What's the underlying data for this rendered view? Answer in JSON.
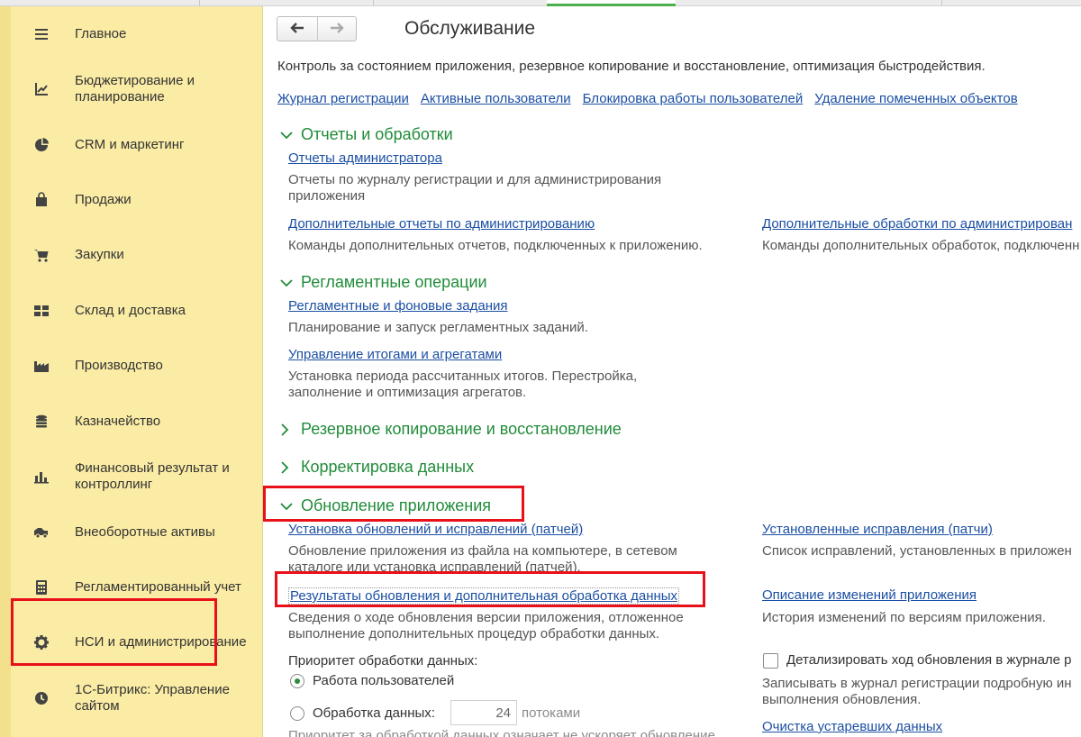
{
  "sidebar": {
    "items": [
      {
        "label": "Главное",
        "icon": "menu-icon"
      },
      {
        "label": "Бюджетирование и планирование",
        "icon": "budget-chart-icon"
      },
      {
        "label": "CRM и маркетинг",
        "icon": "pie-chart-icon"
      },
      {
        "label": "Продажи",
        "icon": "shopping-bag-icon"
      },
      {
        "label": "Закупки",
        "icon": "cart-icon"
      },
      {
        "label": "Склад и доставка",
        "icon": "grid-icon"
      },
      {
        "label": "Производство",
        "icon": "factory-icon"
      },
      {
        "label": "Казначейство",
        "icon": "coins-icon"
      },
      {
        "label": "Финансовый результат и контроллинг",
        "icon": "bar-chart-icon"
      },
      {
        "label": "Внеоборотные активы",
        "icon": "truck-icon"
      },
      {
        "label": "Регламентированный учет",
        "icon": "calculator-icon"
      },
      {
        "label": "НСИ и администрирование",
        "icon": "gear-icon"
      },
      {
        "label": "1С-Битрикс: Управление сайтом",
        "icon": "clock-icon"
      }
    ]
  },
  "header": {
    "title": "Обслуживание",
    "back_icon": "arrow-left-icon",
    "forward_icon": "arrow-right-icon"
  },
  "intro": "Контроль за состоянием приложения, резервное копирование и восстановление, оптимизация быстродействия.",
  "top_links": [
    "Журнал регистрации",
    "Активные пользователи",
    "Блокировка работы пользователей",
    "Удаление помеченных объектов"
  ],
  "sections": {
    "reports": {
      "title": "Отчеты и обработки",
      "admin_reports": {
        "link": "Отчеты администратора",
        "desc": "Отчеты по журналу регистрации и для администрирования приложения"
      },
      "extra_reports": {
        "link": "Дополнительные отчеты по администрированию",
        "desc": "Команды дополнительных отчетов, подключенных к приложению."
      },
      "extra_processing": {
        "link": "Дополнительные обработки по администрирован",
        "desc": "Команды дополнительных обработок, подключенн"
      }
    },
    "routine": {
      "title": "Регламентные операции",
      "jobs": {
        "link": "Регламентные и фоновые задания",
        "desc": "Планирование и запуск регламентных заданий."
      },
      "totals": {
        "link": "Управление итогами и агрегатами",
        "desc": "Установка периода рассчитанных итогов. Перестройка, заполнение и оптимизация агрегатов."
      }
    },
    "backup": {
      "title": "Резервное копирование и восстановление"
    },
    "correction": {
      "title": "Корректировка данных"
    },
    "update": {
      "title": "Обновление приложения",
      "install": {
        "link": "Установка обновлений и исправлений (патчей)",
        "desc": "Обновление приложения из файла на компьютере, в сетевом каталоге или установка исправлений (патчей)."
      },
      "installed_patches": {
        "link": "Установленные исправления (патчи)",
        "desc": "Список исправлений, установленных в приложен"
      },
      "results": {
        "link": "Результаты обновления и дополнительная обработка данных",
        "desc": "Сведения о ходе обновления версии приложения, отложенное выполнение дополнительных процедур обработки данных."
      },
      "changes": {
        "link": "Описание изменений приложения",
        "desc": "История изменений по версиям приложения."
      },
      "priority_label": "Приоритет обработки данных:",
      "option_users": "Работа пользователей",
      "option_data": "Обработка данных:",
      "threads_value": "24",
      "threads_unit": "потоками",
      "detail_checkbox": "Детализировать ход обновления в журнале р",
      "detail_desc": "Записывать в журнал регистрации подробную ин выполнения обновления.",
      "cleanup_link": "Очистка устаревших данных",
      "cut_text": "Приоритет за обработкой данных означает не ускоряет обновление"
    }
  },
  "colors": {
    "sidebar_bg": "#fbeca5",
    "section_green": "#218c3a",
    "link_blue": "#1b4fa3",
    "highlight_red": "#e8111a"
  }
}
